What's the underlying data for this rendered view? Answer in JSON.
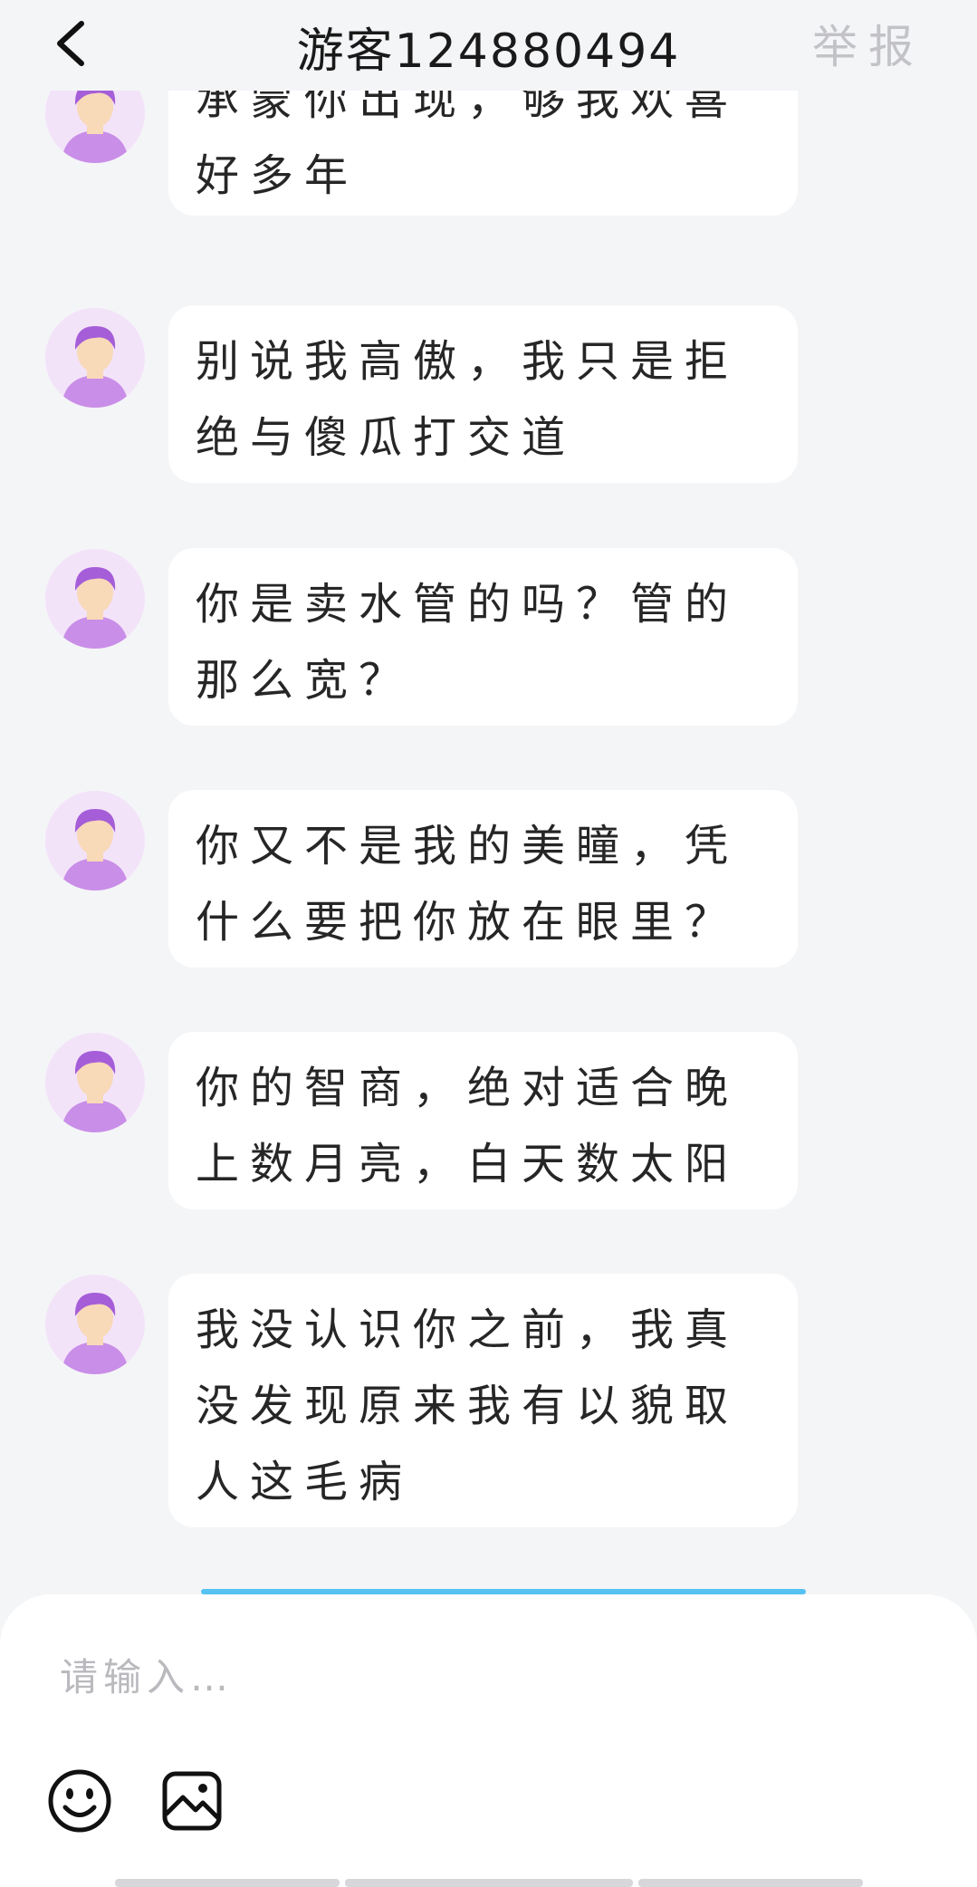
{
  "header": {
    "title": "游客124880494",
    "report_label": "举报"
  },
  "messages": [
    {
      "text": "承蒙你出现，够我欢喜好多年"
    },
    {
      "text": "别说我高傲，我只是拒绝与傻瓜打交道"
    },
    {
      "text": "你是卖水管的吗？管的那么宽？"
    },
    {
      "text": "你又不是我的美瞳，凭什么要把你放在眼里？"
    },
    {
      "text": "你的智商，绝对适合晚上数月亮，白天数太阳"
    },
    {
      "text": "我没认识你之前，我真没发现原来我有以貌取人这毛病"
    }
  ],
  "composer": {
    "placeholder": "请输入…",
    "icons": [
      "emoji-icon",
      "image-icon"
    ]
  },
  "colors": {
    "page_bg": "#f4f5f7",
    "bubble_bg": "#ffffff",
    "avatar_bg": "#f3e3f9",
    "avatar_hair": "#a55ed8",
    "avatar_body": "#c98ee8",
    "avatar_face": "#f8d9b8",
    "report_text": "#c3c3c7",
    "peek_accent": "#56c2f2"
  }
}
